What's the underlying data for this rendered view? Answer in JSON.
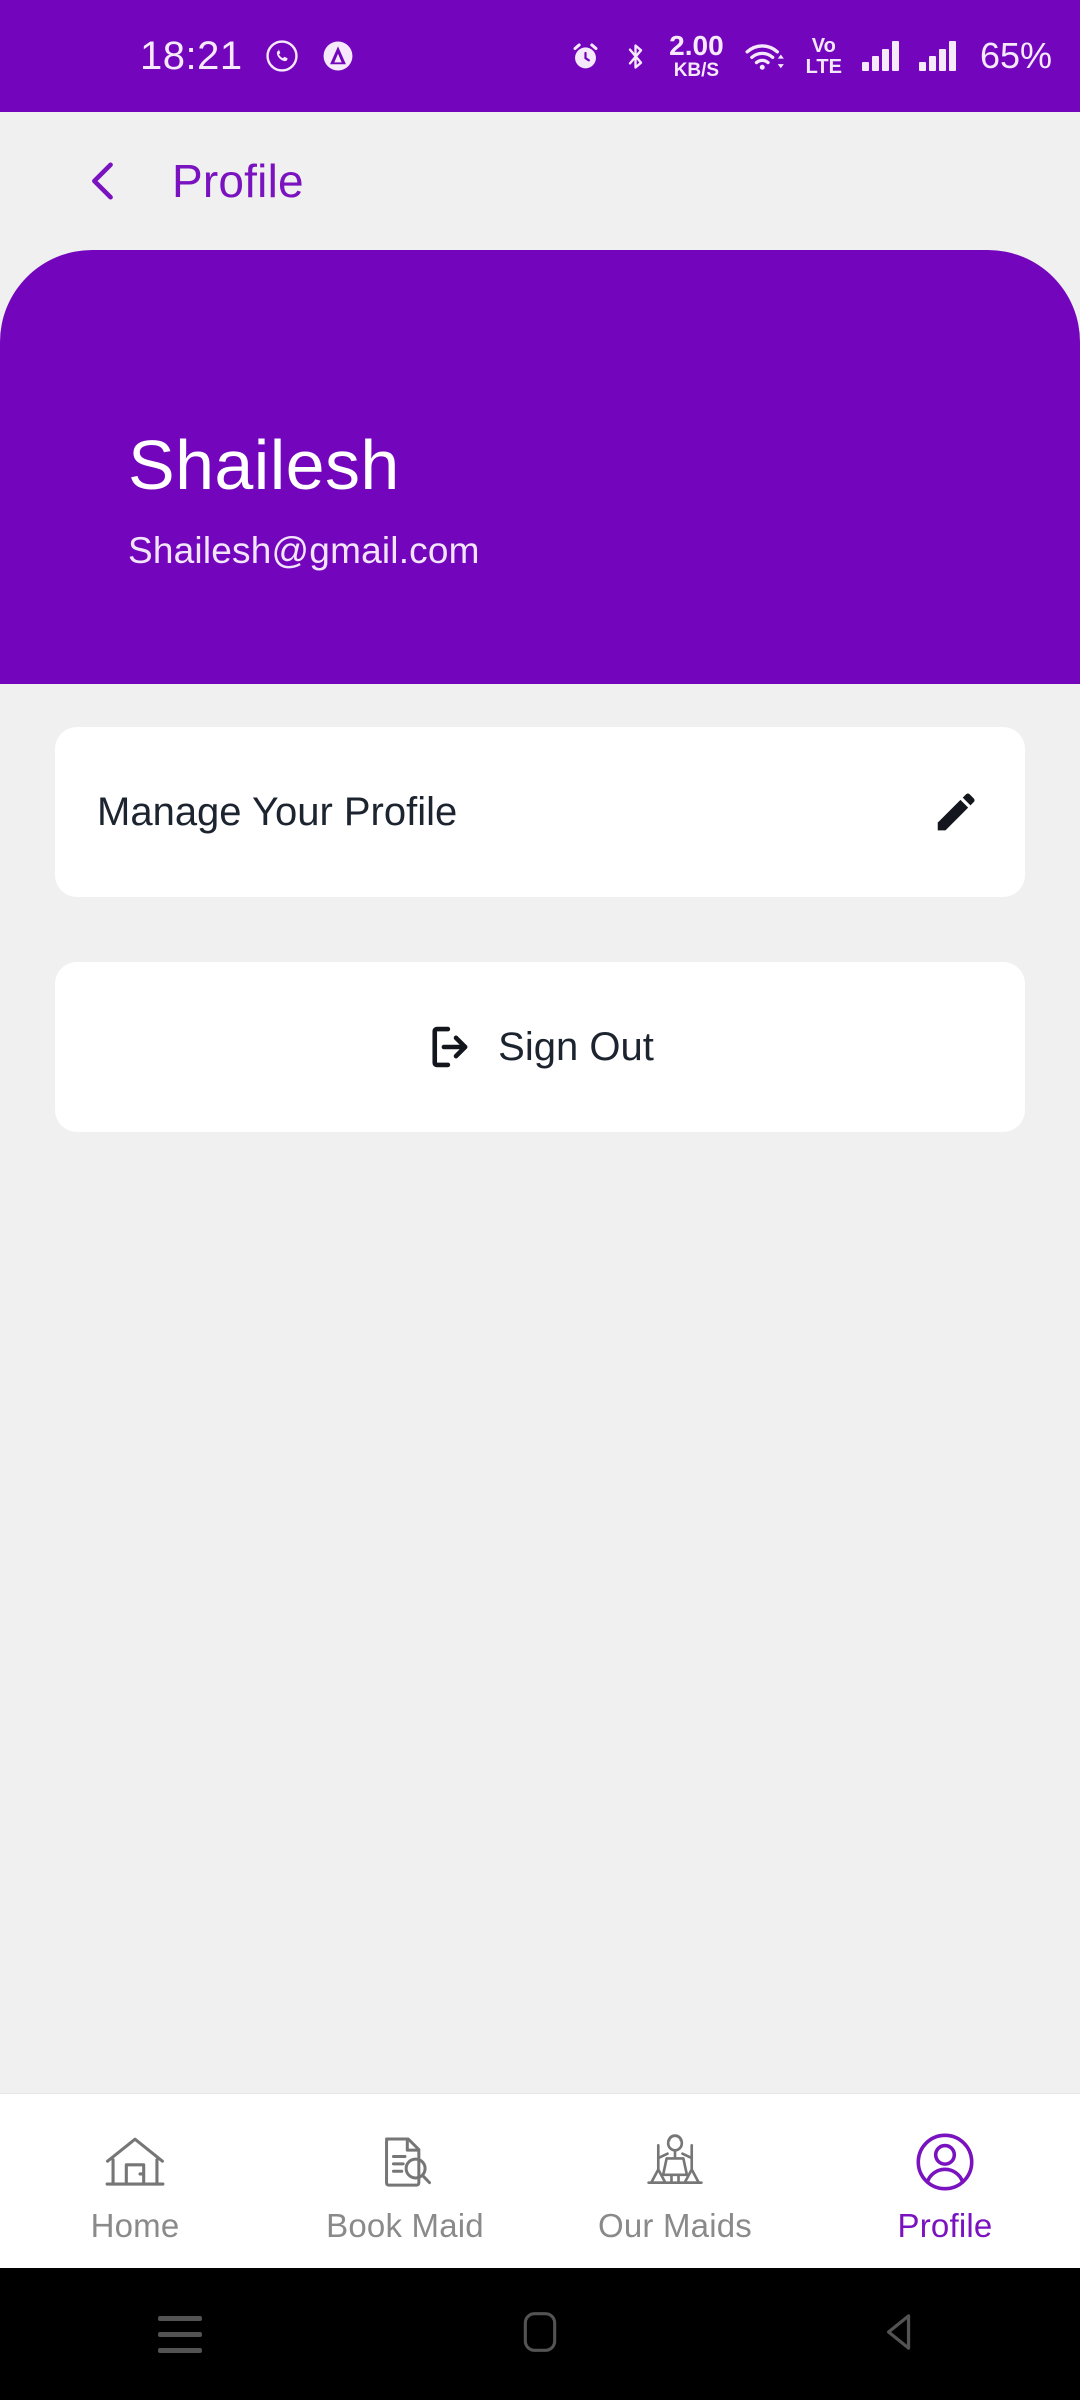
{
  "status_bar": {
    "clock": "18:21",
    "icons_left": [
      "whatsapp-icon",
      "adblock-icon"
    ],
    "alarm_icon": "alarm-icon",
    "bluetooth_icon": "bluetooth-icon",
    "network_speed_value": "2.00",
    "network_speed_unit": "KB/S",
    "wifi_icon": "wifi-icon",
    "volte_line1": "Vo",
    "volte_line2": "LTE",
    "signal_icon_sim1": "signal-bars-icon",
    "signal_icon_sim2": "signal-bars-icon",
    "battery": "65%",
    "background_color": "#7306bc",
    "text_color": "#f6e9fc"
  },
  "header": {
    "back_icon": "back-chevron-icon",
    "title": "Profile",
    "title_color": "#7a12c0",
    "background_color": "#f0f0f0"
  },
  "profile": {
    "name": "Shailesh",
    "email": "Shailesh@gmail.com",
    "card_color": "#7306bc",
    "name_color": "#ffffff",
    "email_color": "#f2e4fb"
  },
  "actions": [
    {
      "label": "Manage Your Profile",
      "icon": "pencil-edit-icon",
      "icon_position": "right"
    },
    {
      "label": "Sign Out",
      "icon": "sign-out-icon",
      "icon_position": "left"
    }
  ],
  "tabbar": {
    "active_color": "#7a12c0",
    "inactive_color": "#8a8a8a",
    "items": [
      {
        "label": "Home",
        "icon": "home-icon",
        "active": false
      },
      {
        "label": "Book Maid",
        "icon": "document-search-icon",
        "active": false
      },
      {
        "label": "Our Maids",
        "icon": "maid-icon",
        "active": false
      },
      {
        "label": "Profile",
        "icon": "user-circle-icon",
        "active": true
      }
    ]
  },
  "android_navbar": {
    "recents_icon": "recents-menu-icon",
    "home_icon": "home-square-icon",
    "back_icon": "back-triangle-icon",
    "background_color": "#000000"
  }
}
